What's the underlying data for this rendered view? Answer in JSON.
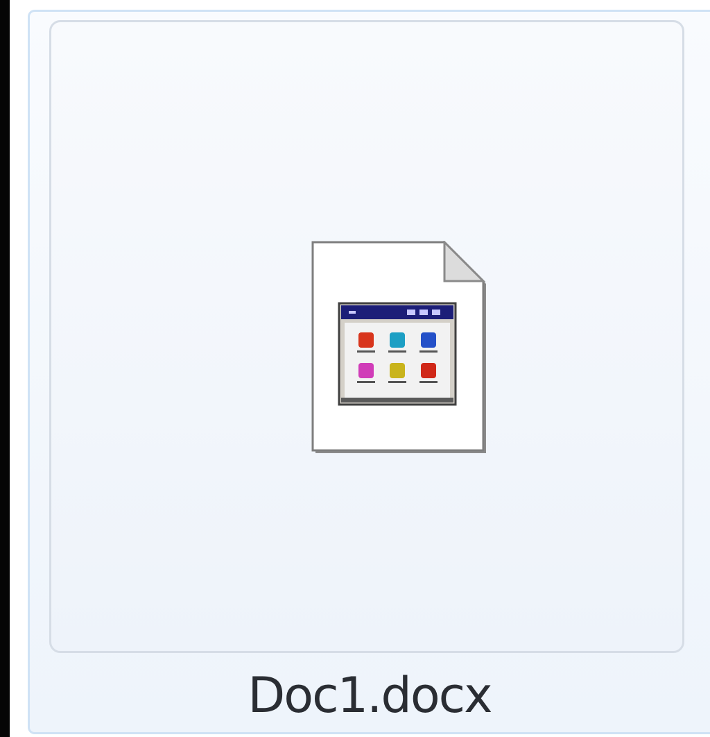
{
  "file": {
    "name": "Doc1.docx",
    "icon": "application-file-icon"
  },
  "colors": {
    "tile_border": "#cfe2f5",
    "window_titlebar": "#1c1e78",
    "app_red": "#d8351c",
    "app_cyan": "#1d9fc4",
    "app_blue": "#2450c8",
    "app_magenta": "#d03cb8",
    "app_yellow": "#c9b41c",
    "app_red2": "#d02818"
  }
}
